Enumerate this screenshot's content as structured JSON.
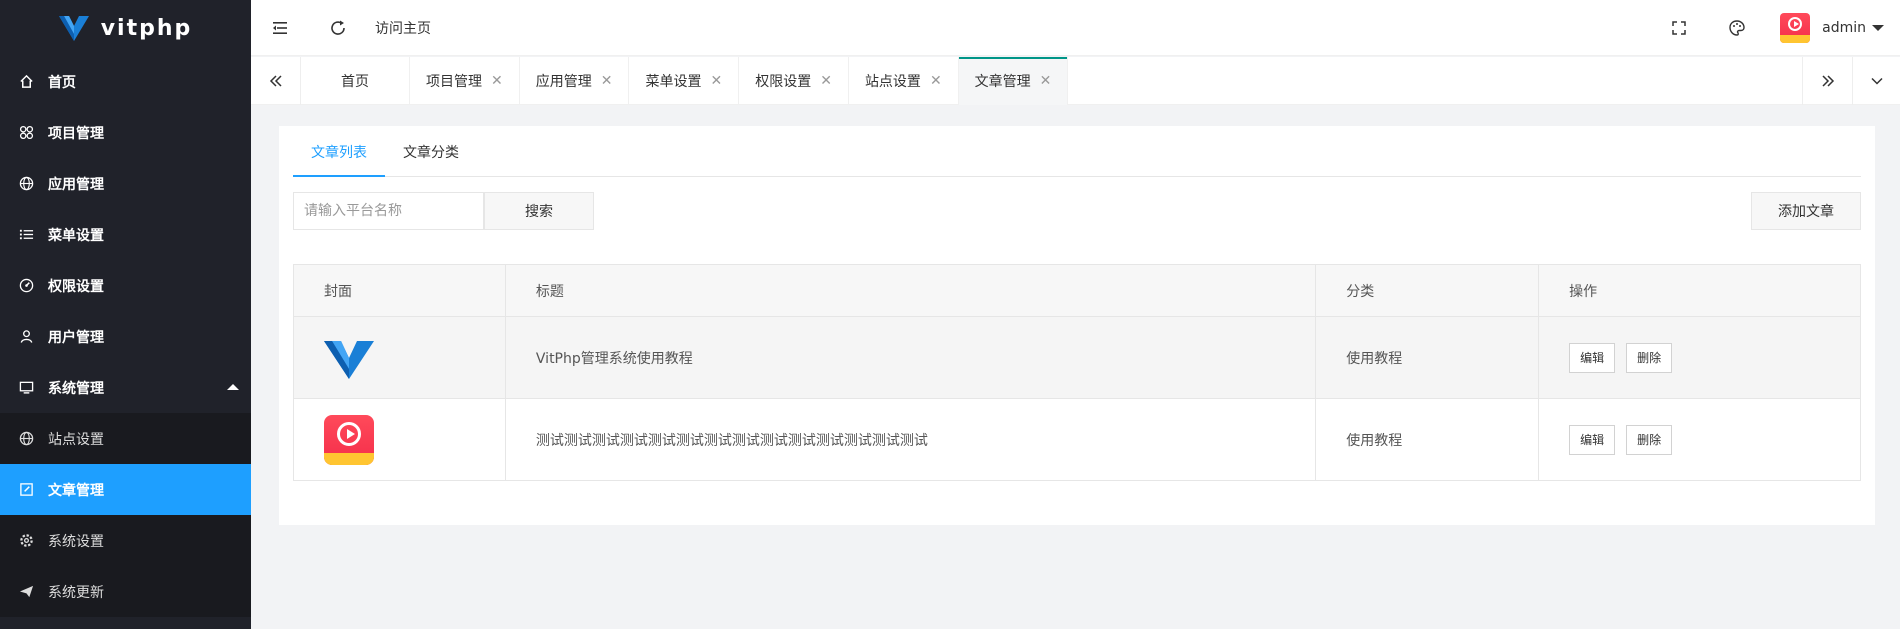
{
  "app": {
    "logo_text": "vitphp"
  },
  "sidebar": {
    "items": [
      {
        "label": "首页",
        "icon": "home-icon"
      },
      {
        "label": "项目管理",
        "icon": "apps-icon"
      },
      {
        "label": "应用管理",
        "icon": "globe-icon"
      },
      {
        "label": "菜单设置",
        "icon": "list-icon"
      },
      {
        "label": "权限设置",
        "icon": "gauge-icon"
      },
      {
        "label": "用户管理",
        "icon": "user-icon"
      },
      {
        "label": "系统管理",
        "icon": "monitor-icon"
      }
    ],
    "subitems": [
      {
        "label": "站点设置",
        "icon": "globe-icon"
      },
      {
        "label": "文章管理",
        "icon": "edit-icon"
      },
      {
        "label": "系统设置",
        "icon": "gear-icon"
      },
      {
        "label": "系统更新",
        "icon": "send-icon"
      }
    ]
  },
  "header": {
    "visit_home": "访问主页",
    "username": "admin"
  },
  "tabs": [
    {
      "label": "首页"
    },
    {
      "label": "项目管理"
    },
    {
      "label": "应用管理"
    },
    {
      "label": "菜单设置"
    },
    {
      "label": "权限设置"
    },
    {
      "label": "站点设置"
    },
    {
      "label": "文章管理"
    }
  ],
  "content": {
    "tabs": [
      "文章列表",
      "文章分类"
    ],
    "search_placeholder": "请输入平台名称",
    "search_label": "搜索",
    "add_label": "添加文章",
    "table": {
      "headers": [
        "封面",
        "标题",
        "分类",
        "操作"
      ],
      "rows": [
        {
          "title": "VitPhp管理系统使用教程",
          "category": "使用教程",
          "edit": "编辑",
          "delete": "删除"
        },
        {
          "title": "测试测试测试测试测试测试测试测试测试测试测试测试测试测试",
          "category": "使用教程",
          "edit": "编辑",
          "delete": "删除"
        }
      ]
    }
  },
  "colors": {
    "accent": "#1e9fff",
    "tab_indicator": "#009688",
    "sidebar_bg": "#20222a"
  }
}
